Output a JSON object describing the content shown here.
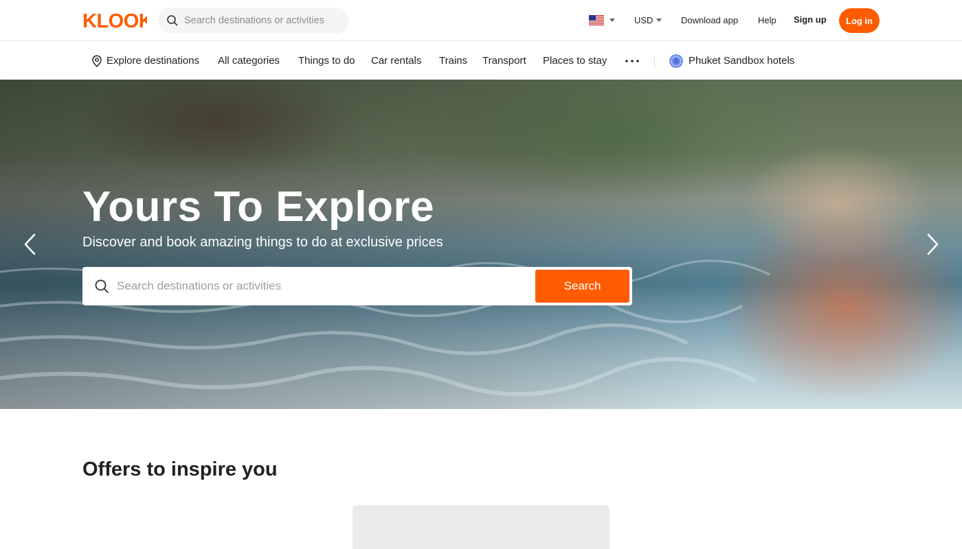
{
  "brand": {
    "name": "KLOOK",
    "accent_color": "#ff5b00"
  },
  "header": {
    "search_placeholder": "Search destinations or activities",
    "flag_icon": "us-flag-icon",
    "currency": "USD",
    "download_app": "Download app",
    "help": "Help",
    "sign_up": "Sign up",
    "log_in": "Log in"
  },
  "nav": {
    "explore": "Explore destinations",
    "items": [
      "All categories",
      "Things to do",
      "Car rentals",
      "Trains",
      "Transport",
      "Places to stay"
    ],
    "more_icon": "more-dots-icon",
    "sandbox": "Phuket Sandbox hotels"
  },
  "hero": {
    "title": "Yours To Explore",
    "subtitle": "Discover and book amazing things to do at exclusive prices",
    "search_placeholder": "Search destinations or activities",
    "search_button": "Search"
  },
  "offers": {
    "title": "Offers to inspire you"
  }
}
